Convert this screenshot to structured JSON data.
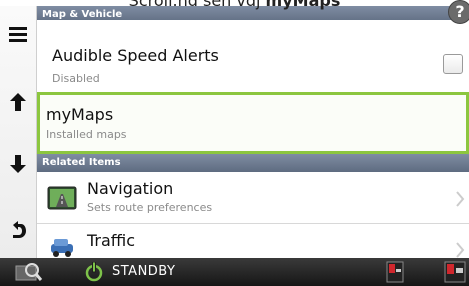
{
  "caption": {
    "prefix": "Scroll.nd seh vdj ",
    "emphasis": "myMaps"
  },
  "sections": {
    "map_vehicle": "Map & Vehicle",
    "related_items": "Related Items"
  },
  "items": {
    "audible": {
      "title": "Audible Speed Alerts",
      "subtitle": "Disabled",
      "checked": false
    },
    "mymaps": {
      "title": "myMaps",
      "subtitle": "Installed maps",
      "selected": true
    },
    "navigation": {
      "title": "Navigation",
      "subtitle": "Sets route preferences"
    },
    "traffic": {
      "title": "Traffic"
    }
  },
  "help": {
    "label": "?"
  },
  "bottom_bar": {
    "status": "STANDBY"
  },
  "colors": {
    "selection_border": "#8cc63f",
    "section_header": "#6a778c",
    "bottom_bar": "#1e1e1e"
  },
  "icons": {
    "menu": "hamburger-menu-icon",
    "up": "arrow-up-icon",
    "down": "arrow-down-icon",
    "back": "back-arrow-icon",
    "search": "map-search-icon",
    "power": "power-icon",
    "help": "help-icon"
  }
}
